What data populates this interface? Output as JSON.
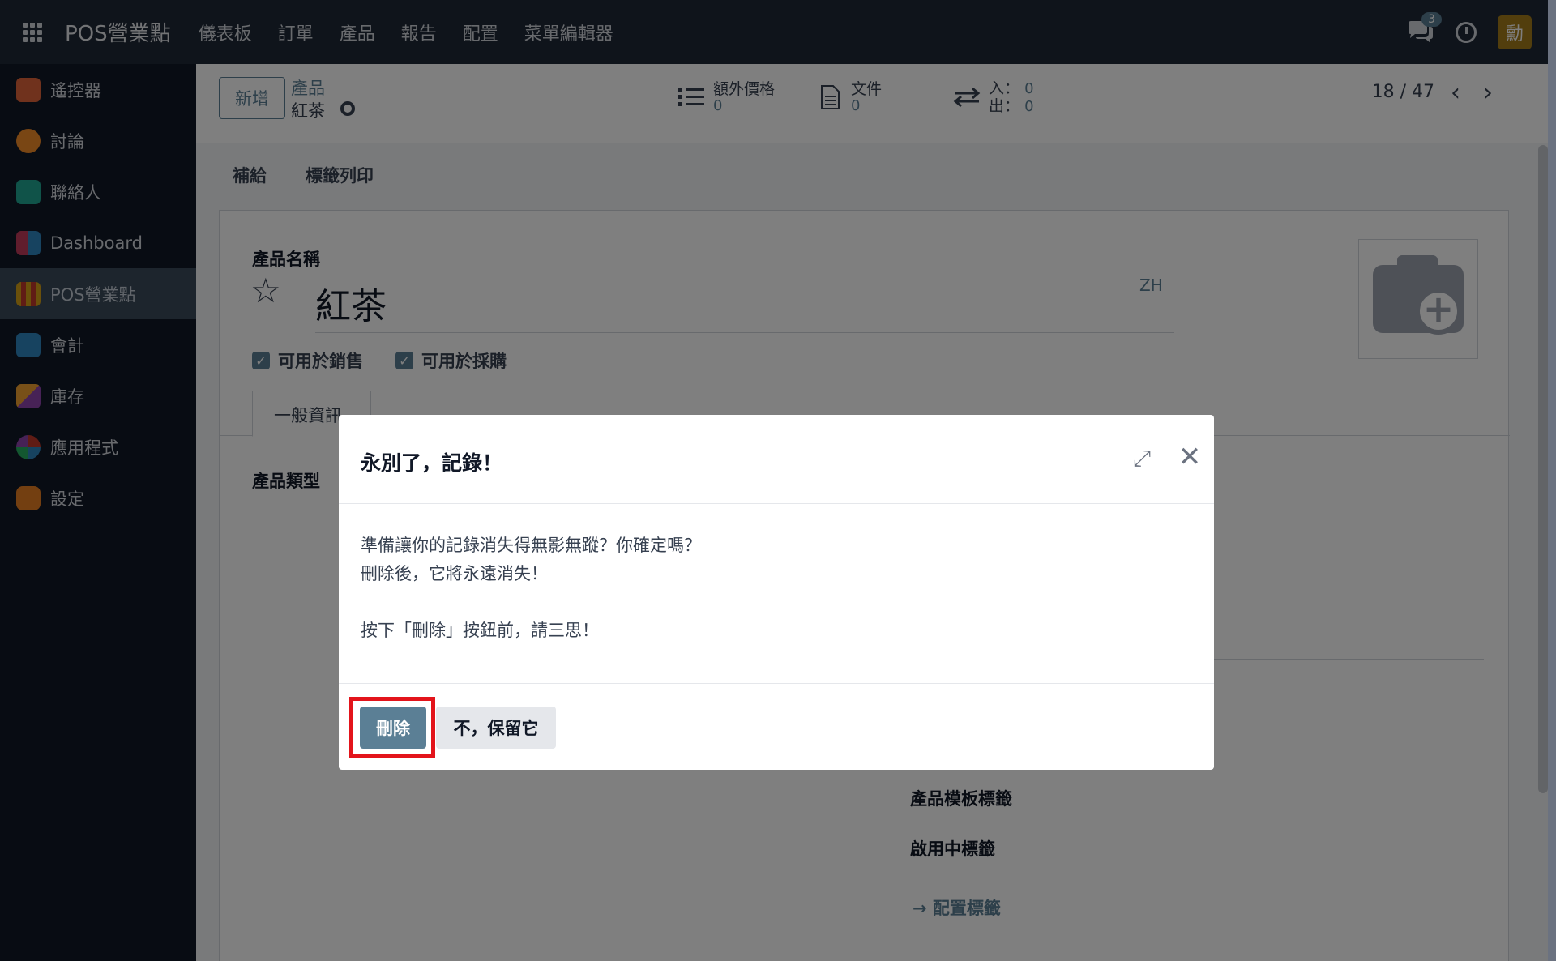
{
  "topbar": {
    "brand": "POS營業點",
    "menu": [
      "儀表板",
      "訂單",
      "產品",
      "報告",
      "配置",
      "菜單編輯器"
    ],
    "chat_count": "3",
    "avatar_letter": "勳"
  },
  "sidebar": {
    "items": [
      {
        "label": "遙控器",
        "icon": "remote-icon",
        "color": "#e0643b"
      },
      {
        "label": "討論",
        "icon": "discuss-icon",
        "color": "#f28c28"
      },
      {
        "label": "聯絡人",
        "icon": "contacts-icon",
        "color": "#21a693"
      },
      {
        "label": "Dashboard",
        "icon": "dashboard-icon",
        "color": "#c13a5b"
      },
      {
        "label": "POS營業點",
        "icon": "pos-icon",
        "color": "#d4a017"
      },
      {
        "label": "會計",
        "icon": "accounting-icon",
        "color": "#2e86c1"
      },
      {
        "label": "庫存",
        "icon": "inventory-icon",
        "color": "#e07b2c"
      },
      {
        "label": "應用程式",
        "icon": "apps-icon",
        "color": "#c0392b"
      },
      {
        "label": "設定",
        "icon": "settings-icon",
        "color": "#e67e22"
      }
    ]
  },
  "control_panel": {
    "new_button": "新增",
    "breadcrumb_parent": "產品",
    "breadcrumb_current": "紅茶",
    "smart_buttons": {
      "extra_price_label": "額外價格",
      "extra_price_value": "0",
      "documents_label": "文件",
      "documents_value": "0",
      "in_label": "入：",
      "in_value": "0",
      "out_label": "出：",
      "out_value": "0"
    },
    "pager": "18 / 47"
  },
  "action_bar": {
    "replenish": "補給",
    "print_labels": "標籤列印"
  },
  "form": {
    "name_label": "產品名稱",
    "name_value": "紅茶",
    "lang": "ZH",
    "can_be_sold": "可用於銷售",
    "can_be_purchased": "可用於採購",
    "tab_general": "一般資訊",
    "product_type_label": "產品類型",
    "template_tags_label": "產品模板標籤",
    "active_tags_label": "啟用中標籤",
    "configure_tags_link": "配置標籤"
  },
  "modal": {
    "title": "永別了，記錄！",
    "line1": "準備讓你的記錄消失得無影無蹤？你確定嗎？",
    "line2": "刪除後，它將永遠消失！",
    "line3": "按下「刪除」按鈕前，請三思！",
    "delete_button": "刪除",
    "keep_button": "不，保留它"
  },
  "colors": {
    "accent": "#5b7f95",
    "navbar": "#1f2937",
    "sidebar": "#111827",
    "highlight": "#e3141b"
  }
}
